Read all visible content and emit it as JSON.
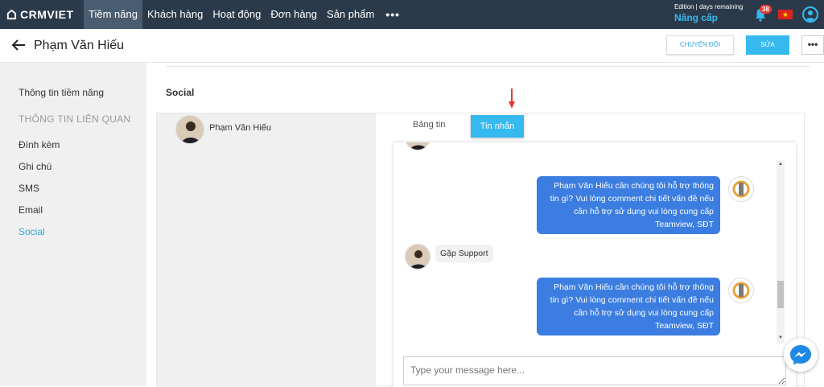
{
  "brand": {
    "name": "CRMVIET"
  },
  "nav": {
    "items": [
      {
        "label": "Tiềm năng",
        "active": true
      },
      {
        "label": "Khách hàng",
        "active": false
      },
      {
        "label": "Hoạt động",
        "active": false
      },
      {
        "label": "Đơn hàng",
        "active": false
      },
      {
        "label": "Sản phẩm",
        "active": false
      }
    ],
    "more_label": "•••",
    "edition_text": "Edition | days remaining",
    "upgrade_label": "Nâng cấp",
    "notification_count": "38"
  },
  "header": {
    "title": "Phạm Văn Hiếu",
    "convert_label": "CHUYỂN ĐỔI",
    "edit_label": "SỬA",
    "more_label": "•••"
  },
  "sidebar": {
    "top_item": "Thông tin tiềm năng",
    "section_label": "THÔNG TIN LIÊN QUAN",
    "items": [
      {
        "label": "Đính kèm"
      },
      {
        "label": "Ghi chú"
      },
      {
        "label": "SMS"
      },
      {
        "label": "Email"
      },
      {
        "label": "Social",
        "active": true
      }
    ]
  },
  "social": {
    "title": "Social",
    "contact_name": "Phạm Văn Hiếu",
    "tabs": {
      "feed": "Bảng tin",
      "messages": "Tin nhắn"
    },
    "messages": [
      {
        "direction": "out",
        "text": "Phạm Văn Hiếu cần chúng tôi hỗ trợ thông tin gì? Vui lòng comment chi tiết vấn đề nếu cần hỗ trợ sử dụng vui lòng cung cấp Teamview, SĐT"
      },
      {
        "direction": "in",
        "text": "Gặp Support"
      },
      {
        "direction": "out",
        "text": "Phạm Văn Hiếu cần chúng tôi hỗ trợ thông tin gì? Vui lòng comment chi tiết vấn đề nếu cần hỗ trợ sử dụng vui lòng cung cấp Teamview, SĐT"
      }
    ],
    "input_placeholder": "Type your message here..."
  },
  "colors": {
    "accent": "#35b9ef",
    "nav_bg": "#2b3a4a",
    "bubble_out": "#3b7de0",
    "indicator": "#e53935"
  }
}
